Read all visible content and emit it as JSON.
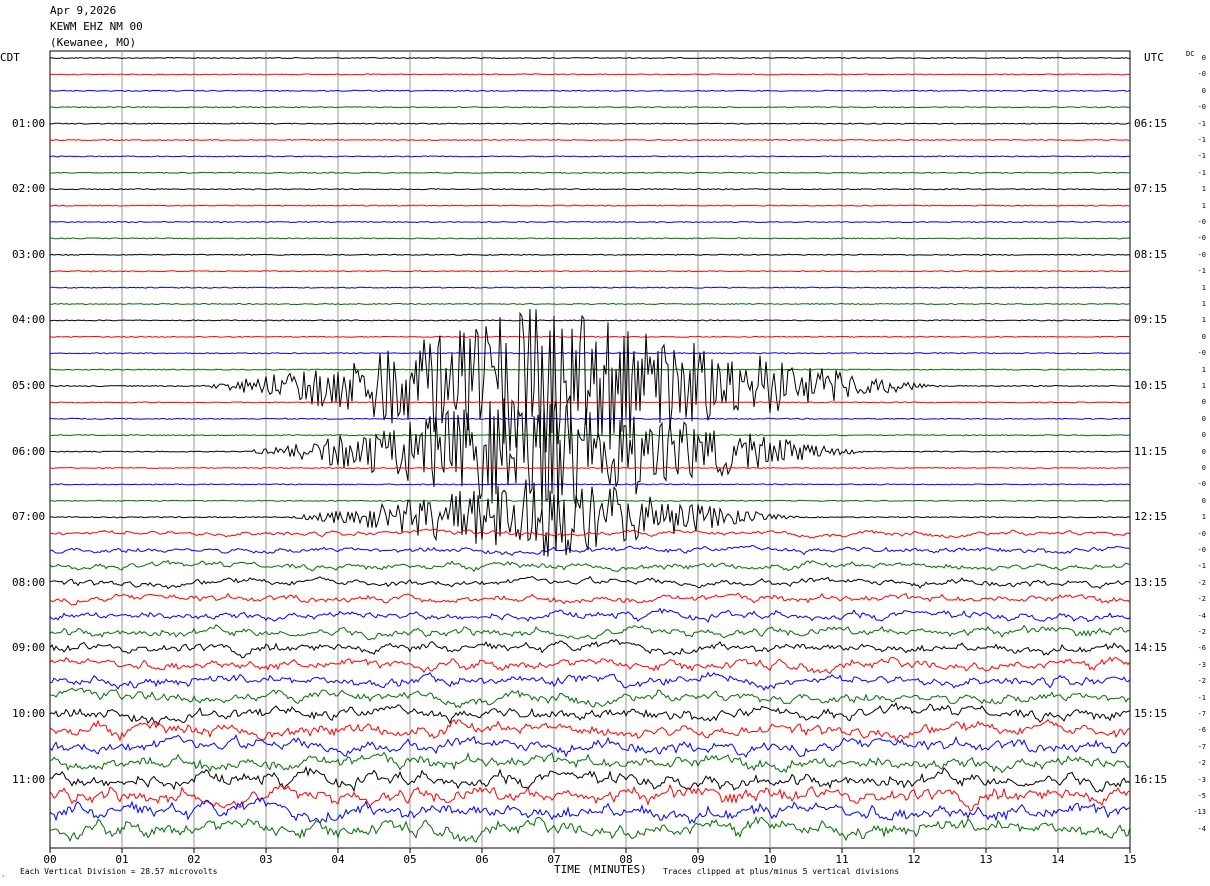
{
  "header": {
    "date": "Apr 9,2026",
    "station": "KEWM EHZ NM 00",
    "location": "(Kewanee, MO)"
  },
  "left_zone": "CDT",
  "right_zone": "UTC",
  "dc_label": "DC",
  "footer": {
    "scale_text": "Each Vertical Division =   28.57 microvolts",
    "clip_text": "Traces clipped at plus/minus 5 vertical divisions",
    "corner_mark": "‸"
  },
  "chart_data": {
    "type": "line",
    "title": "",
    "xlabel": "TIME (MINUTES)",
    "ylabel": "",
    "xlim": [
      0,
      15
    ],
    "x_ticks": [
      "00",
      "01",
      "02",
      "03",
      "04",
      "05",
      "06",
      "07",
      "08",
      "09",
      "10",
      "11",
      "12",
      "13",
      "14",
      "15"
    ],
    "trace_count": 48,
    "trace_colors": [
      "#000000",
      "#ff0000",
      "#0000ff",
      "#007000"
    ],
    "left_time_labels": [
      {
        "row": 4,
        "text": "01:00"
      },
      {
        "row": 8,
        "text": "02:00"
      },
      {
        "row": 12,
        "text": "03:00"
      },
      {
        "row": 16,
        "text": "04:00"
      },
      {
        "row": 20,
        "text": "05:00"
      },
      {
        "row": 24,
        "text": "06:00"
      },
      {
        "row": 28,
        "text": "07:00"
      },
      {
        "row": 32,
        "text": "08:00"
      },
      {
        "row": 36,
        "text": "09:00"
      },
      {
        "row": 40,
        "text": "10:00"
      },
      {
        "row": 44,
        "text": "11:00"
      }
    ],
    "right_time_labels": [
      {
        "row": 4,
        "text": "06:15"
      },
      {
        "row": 8,
        "text": "07:15"
      },
      {
        "row": 12,
        "text": "08:15"
      },
      {
        "row": 16,
        "text": "09:15"
      },
      {
        "row": 20,
        "text": "10:15"
      },
      {
        "row": 24,
        "text": "11:15"
      },
      {
        "row": 28,
        "text": "12:15"
      },
      {
        "row": 32,
        "text": "13:15"
      },
      {
        "row": 36,
        "text": "14:15"
      },
      {
        "row": 40,
        "text": "15:15"
      },
      {
        "row": 44,
        "text": "16:15"
      }
    ],
    "dc_offsets": [
      "0",
      "-0",
      "0",
      "-0",
      "-1",
      "-1",
      "-1",
      "-1",
      "1",
      "1",
      "-0",
      "-0",
      "-0",
      "-1",
      "1",
      "1",
      "1",
      "0",
      "-0",
      "1",
      "1",
      "0",
      "0",
      "0",
      "0",
      "0",
      "-0",
      "0",
      "1",
      "-0",
      "-0",
      "-1",
      "-2",
      "-2",
      "-4",
      "-2",
      "-6",
      "-3",
      "-2",
      "-1",
      "-7",
      "-6",
      "-7",
      "-2",
      "-3",
      "-5",
      "-13",
      "-4"
    ],
    "events": [
      {
        "rows": [
          20,
          24,
          28
        ],
        "start_min": 2.0,
        "peak_min": 6.8,
        "end_min": 12.5,
        "description": "large regional earthquake"
      }
    ],
    "noise_increase_from_row": 29,
    "clip_divisions": 5,
    "microvolts_per_division": 28.57
  }
}
